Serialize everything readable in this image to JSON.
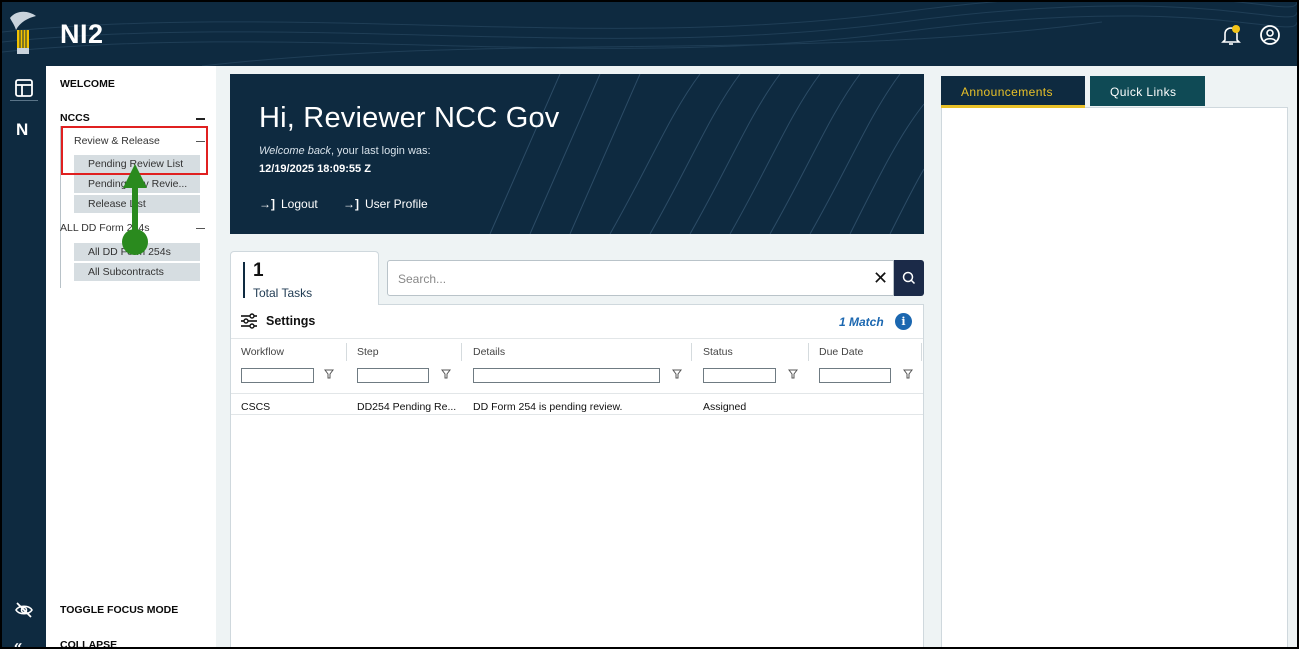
{
  "app": {
    "title": "NI2"
  },
  "header": {
    "bell_icon": "bell-icon",
    "user_icon": "user-circle-icon",
    "notification_dot_color": "#f5c518"
  },
  "rail": {
    "items": [
      {
        "icon": "layout-icon"
      },
      {
        "label": "N"
      }
    ]
  },
  "sidebar": {
    "welcome": "WELCOME",
    "section": "NCCS",
    "group1": {
      "label": "Review & Release",
      "items": [
        "Pending Review List",
        "Pending Gov Revie...",
        "Release List"
      ]
    },
    "group2": {
      "label": "ALL DD Form 254s",
      "items": [
        "All DD Form 254s",
        "All Subcontracts"
      ]
    },
    "toggle_focus": "TOGGLE FOCUS MODE",
    "collapse": "COLLAPSE"
  },
  "banner": {
    "greeting": "Hi, Reviewer NCC Gov",
    "welcome_em": "Welcome back",
    "welcome_rest": ", your last login was:",
    "last_login": "12/19/2025 18:09:55 Z",
    "logout": "Logout",
    "profile": "User Profile"
  },
  "tasks": {
    "count": "1",
    "count_label": "Total Tasks",
    "search_placeholder": "Search...",
    "settings_label": "Settings",
    "match_text": "1 Match",
    "columns": [
      "Workflow",
      "Step",
      "Details",
      "Status",
      "Due Date"
    ],
    "rows": [
      {
        "workflow": "CSCS",
        "step": "DD254 Pending Re...",
        "details": "DD Form 254 is pending review.",
        "status": "Assigned",
        "due_date": ""
      }
    ]
  },
  "right_panel": {
    "tabs": [
      "Announcements",
      "Quick Links"
    ],
    "active_tab": "Announcements"
  },
  "colors": {
    "navy": "#0e2a40",
    "accent_yellow": "#e8c028",
    "link_blue": "#1b67b0",
    "annotation_red": "#e02020",
    "annotation_green": "#2a8a1e"
  }
}
